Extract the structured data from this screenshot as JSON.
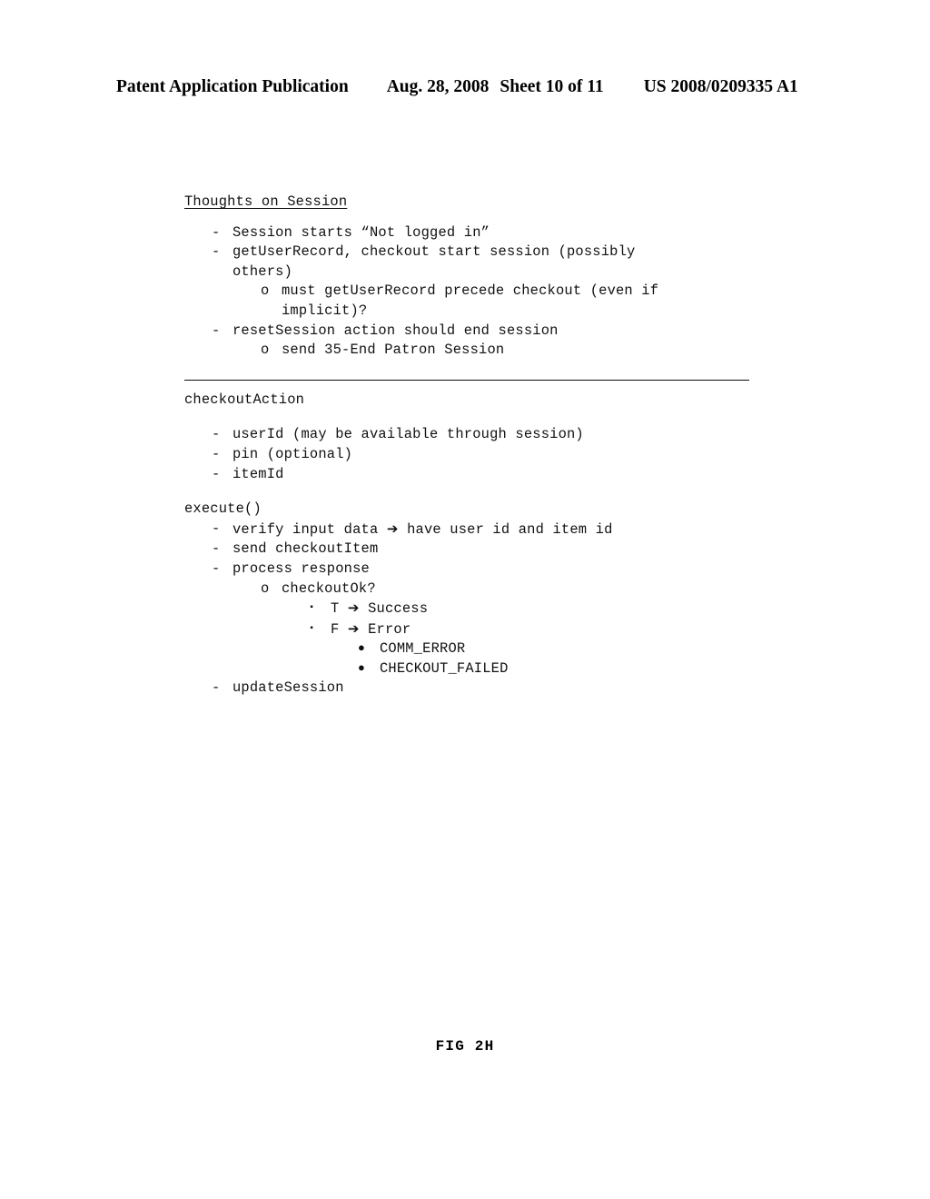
{
  "header": {
    "publication": "Patent Application Publication",
    "date": "Aug. 28, 2008",
    "sheet": "Sheet 10 of 11",
    "patent_number": "US 2008/0209335 A1"
  },
  "figure": {
    "caption": "FIG 2H"
  },
  "session_section": {
    "title": "Thoughts on Session",
    "b1_marker": "-",
    "b1_text": "Session starts “Not logged in”",
    "b2_marker": "-",
    "b2_text": "getUserRecord, checkout start session (possibly",
    "b2_cont": "others)",
    "b3_marker": "o",
    "b3_text": "must getUserRecord precede checkout (even if",
    "b3_cont": "implicit)?",
    "b4_marker": "-",
    "b4_text": "resetSession action should end session",
    "b5_marker": "o",
    "b5_text": "send 35-End Patron Session"
  },
  "checkout_section": {
    "heading": "checkoutAction",
    "b1_marker": "-",
    "b1_text": "userId (may be available through session)",
    "b2_marker": "-",
    "b2_text": "pin (optional)",
    "b3_marker": "-",
    "b3_text": "itemId"
  },
  "execute_section": {
    "heading": "execute()",
    "b1_marker": "-",
    "b1_pre": "verify input data ",
    "b1_arrow": "➔",
    "b1_post": " have user id and item id",
    "b2_marker": "-",
    "b2_text": "send checkoutItem",
    "b3_marker": "-",
    "b3_text": "process response",
    "b4_marker": "o",
    "b4_text": "checkoutOk?",
    "b5_marker": "▪",
    "b5_pre": "T ",
    "b5_arrow": "➔",
    "b5_post": " Success",
    "b6_marker": "▪",
    "b6_pre": "F ",
    "b6_arrow": "➔",
    "b6_post": " Error",
    "b7_marker": "●",
    "b7_text": "COMM_ERROR",
    "b8_marker": "●",
    "b8_text": "CHECKOUT_FAILED",
    "b9_marker": "-",
    "b9_text": "updateSession"
  }
}
